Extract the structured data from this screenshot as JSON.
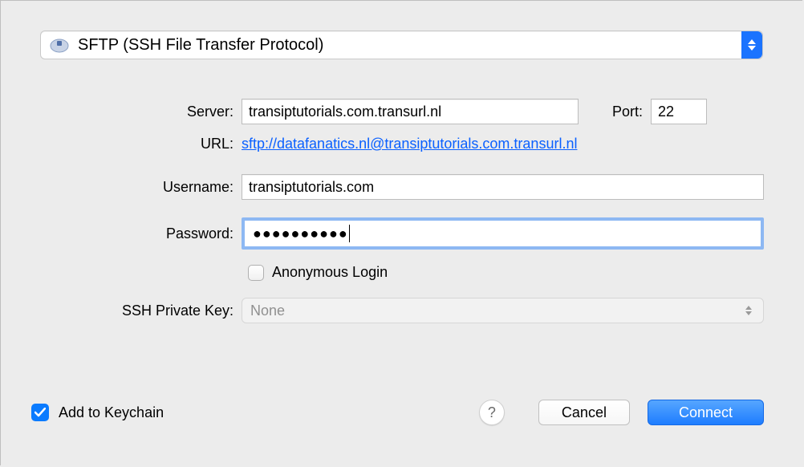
{
  "protocol": {
    "label": "SFTP (SSH File Transfer Protocol)"
  },
  "labels": {
    "server": "Server:",
    "port": "Port:",
    "url": "URL:",
    "username": "Username:",
    "password": "Password:",
    "anonymous": "Anonymous Login",
    "sshkey": "SSH Private Key:",
    "keychain": "Add to Keychain"
  },
  "fields": {
    "server": "transiptutorials.com.transurl.nl",
    "port": "22",
    "url": "sftp://datafanatics.nl@transiptutorials.com.transurl.nl",
    "username": "transiptutorials.com",
    "password_dots": "●●●●●●●●●●",
    "sshkey": "None"
  },
  "buttons": {
    "help": "?",
    "cancel": "Cancel",
    "connect": "Connect"
  }
}
